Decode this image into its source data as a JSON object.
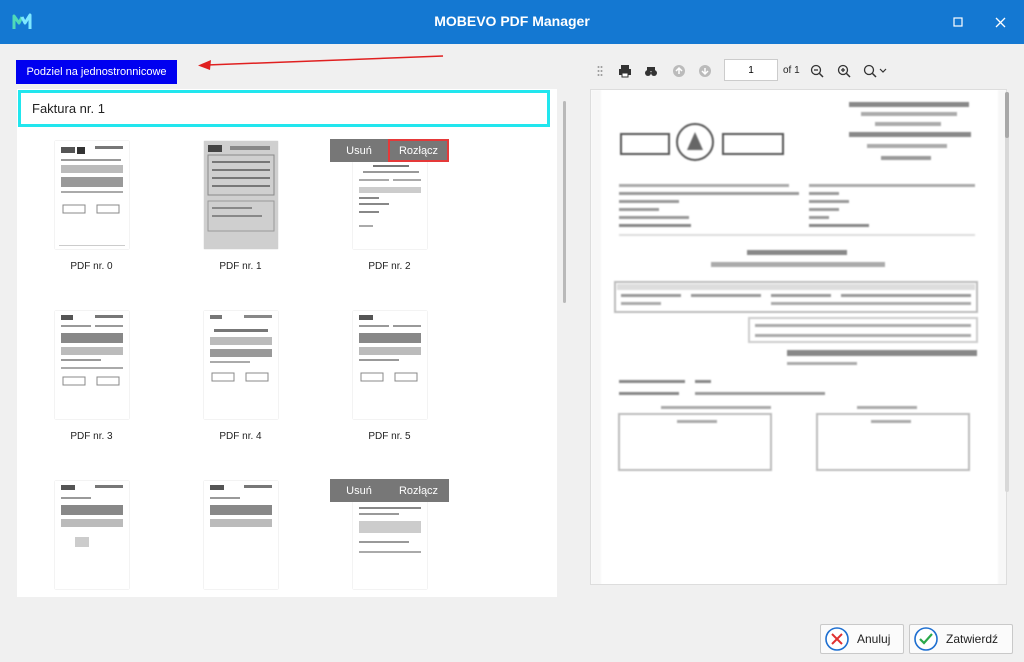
{
  "window": {
    "title": "MOBEVO PDF Manager"
  },
  "toolbar": {
    "split_label": "Podziel na jednostronnicowe"
  },
  "document": {
    "title": "Faktura nr. 1"
  },
  "thumbnails": [
    {
      "label": "PDF nr. 0"
    },
    {
      "label": "PDF nr. 1"
    },
    {
      "label": "PDF nr. 2"
    },
    {
      "label": "PDF nr. 3"
    },
    {
      "label": "PDF nr. 4"
    },
    {
      "label": "PDF nr. 5"
    }
  ],
  "overlay": {
    "delete_label": "Usuń",
    "split_label": "Rozłącz"
  },
  "viewer": {
    "page_value": "1",
    "of_label": "of 1"
  },
  "actions": {
    "cancel_label": "Anuluj",
    "confirm_label": "Zatwierdź"
  },
  "colors": {
    "titlebar": "#1478d2",
    "split_button": "#0000f0",
    "doc_border": "#21e6ee",
    "highlight": "#e53939"
  },
  "icons": [
    "app-logo-icon",
    "maximize-icon",
    "close-icon",
    "print-icon",
    "find-icon",
    "page-up-icon",
    "page-down-icon",
    "zoom-out-icon",
    "zoom-in-icon",
    "zoom-menu-icon",
    "cancel-icon",
    "confirm-icon"
  ]
}
